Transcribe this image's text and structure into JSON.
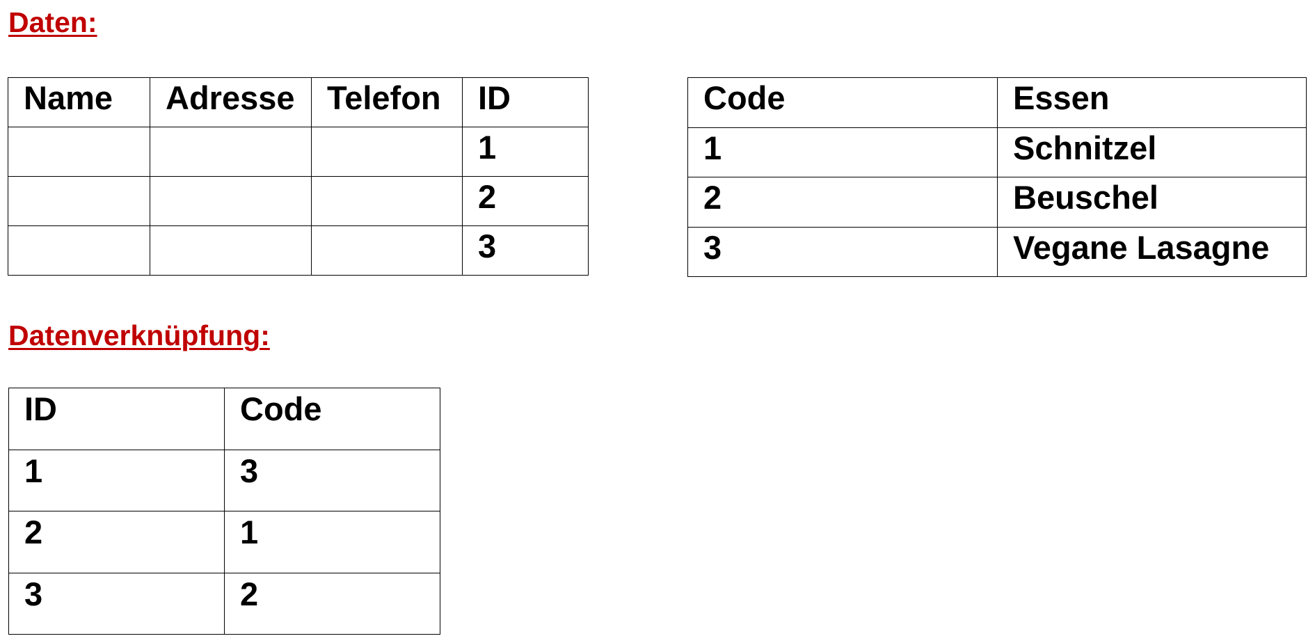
{
  "headings": {
    "data": "Daten:",
    "linking": "Datenverknüpfung:"
  },
  "persons_table": {
    "headers": [
      "Name",
      "Adresse",
      "Telefon",
      "ID"
    ],
    "rows": [
      [
        "",
        "",
        "",
        "1"
      ],
      [
        "",
        "",
        "",
        "2"
      ],
      [
        "",
        "",
        "",
        "3"
      ]
    ]
  },
  "food_table": {
    "headers": [
      "Code",
      "Essen"
    ],
    "rows": [
      [
        "1",
        "Schnitzel"
      ],
      [
        "2",
        "Beuschel"
      ],
      [
        "3",
        "Vegane Lasagne"
      ]
    ]
  },
  "link_table": {
    "headers": [
      "ID",
      "Code"
    ],
    "rows": [
      [
        "1",
        "3"
      ],
      [
        "2",
        "1"
      ],
      [
        "3",
        "2"
      ]
    ]
  },
  "colors": {
    "heading": "#c00000",
    "text": "#000000",
    "border": "#000000",
    "background": "#ffffff"
  }
}
